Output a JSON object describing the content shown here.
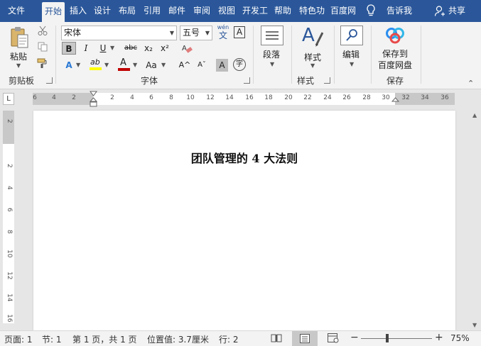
{
  "tabs": [
    {
      "label": "文件",
      "active": false
    },
    {
      "label": "开始",
      "active": true
    },
    {
      "label": "插入",
      "active": false
    },
    {
      "label": "设计",
      "active": false
    },
    {
      "label": "布局",
      "active": false
    },
    {
      "label": "引用",
      "active": false
    },
    {
      "label": "邮件",
      "active": false
    },
    {
      "label": "审阅",
      "active": false
    },
    {
      "label": "视图",
      "active": false
    },
    {
      "label": "开发工",
      "active": false
    },
    {
      "label": "帮助",
      "active": false
    },
    {
      "label": "特色功",
      "active": false
    },
    {
      "label": "百度网",
      "active": false
    }
  ],
  "tell_me": "告诉我",
  "share": "共享",
  "clipboard": {
    "paste": "粘贴",
    "group": "剪贴板"
  },
  "font": {
    "name": "宋体",
    "size": "五号",
    "wen_top": "wén",
    "wen_bottom": "文",
    "bold": "B",
    "italic": "I",
    "underline": "U",
    "strike": "abc",
    "sub": "x₂",
    "sup": "x²",
    "highlight": "ab",
    "fontcolor": "A",
    "case": "Aa",
    "grow": "A^",
    "shrink": "Aˇ",
    "shade": "A",
    "enclose": "字",
    "group": "字体"
  },
  "paragraph": {
    "label": "段落"
  },
  "styles": {
    "label": "样式",
    "group": "样式"
  },
  "editing": {
    "label": "编辑"
  },
  "save": {
    "label1": "保存到",
    "label2": "百度网盘",
    "group": "保存"
  },
  "ruler": {
    "corner": "L",
    "ticks": [
      "6",
      "4",
      "2",
      "2",
      "4",
      "6",
      "8",
      "10",
      "12",
      "14",
      "16",
      "18",
      "20",
      "22",
      "24",
      "26",
      "28",
      "30",
      "32",
      "34",
      "36"
    ]
  },
  "vruler": [
    "2",
    "2",
    "4",
    "6",
    "8",
    "10",
    "12",
    "14",
    "16"
  ],
  "document": {
    "title": "团队管理的 4 大法则"
  },
  "status": {
    "page": "页面: 1",
    "section": "节: 1",
    "pages": "第 1 页，共 1 页",
    "position": "位置值: 3.7厘米",
    "line": "行: 2",
    "zoom": "75%",
    "zoom_minus": "−",
    "zoom_plus": "+"
  },
  "colors": {
    "accent": "#2b579a",
    "font_color": "#c00000",
    "highlight": "#ffff00",
    "doc_bg": "#ffffff"
  }
}
